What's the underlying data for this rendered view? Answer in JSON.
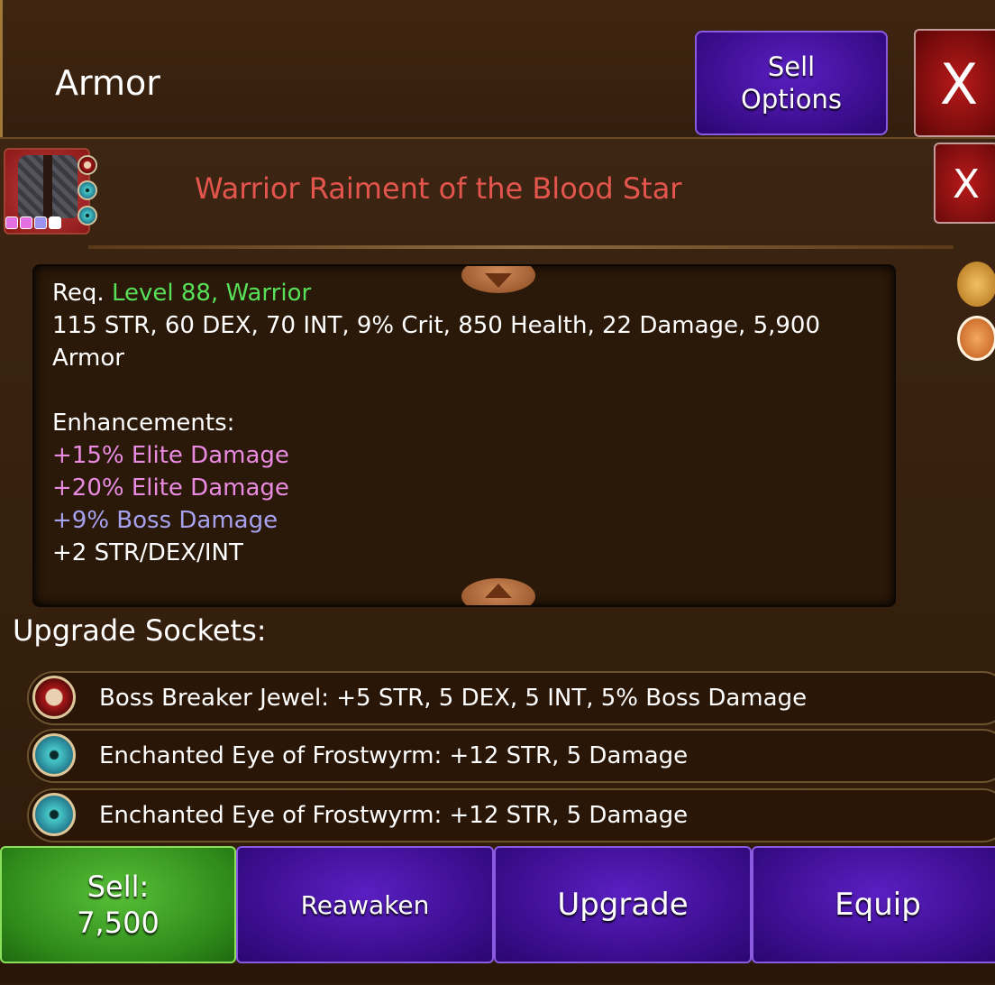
{
  "header": {
    "title": "Armor",
    "sell_options_label": "Sell\nOptions",
    "close_label": "X"
  },
  "item": {
    "name": "Warrior Raiment of the Blood Star",
    "name_color": "#e4554e",
    "close_label": "X",
    "requirement_prefix": "Req.",
    "requirement_value": "Level 88, Warrior",
    "stats_line": "115 STR, 60 DEX, 70 INT, 9% Crit, 850 Health, 22 Damage, 5,900 Armor",
    "enhancements_title": "Enhancements:",
    "enhancements": [
      {
        "text": "+15% Elite Damage",
        "color": "#e98be0"
      },
      {
        "text": "+20% Elite Damage",
        "color": "#e98be0"
      },
      {
        "text": "+9% Boss Damage",
        "color": "#a7a2f0"
      },
      {
        "text": "+2 STR/DEX/INT",
        "color": "#ffffff"
      }
    ],
    "gem_colors": [
      "#e46fe0",
      "#e46fe0",
      "#9b93f0",
      "#ffffff"
    ]
  },
  "sockets": {
    "title": "Upgrade Sockets:",
    "items": [
      {
        "icon": "skull-jewel-icon",
        "text": "Boss Breaker Jewel: +5 STR, 5 DEX, 5 INT, 5% Boss Damage"
      },
      {
        "icon": "frostwyrm-eye-icon",
        "text": "Enchanted Eye of Frostwyrm: +12 STR, 5 Damage"
      },
      {
        "icon": "frostwyrm-eye-icon",
        "text": "Enchanted Eye of Frostwyrm: +12 STR, 5 Damage"
      }
    ]
  },
  "actions": {
    "sell_label": "Sell:",
    "sell_value": "7,500",
    "reawaken_label": "Reawaken",
    "upgrade_label": "Upgrade",
    "equip_label": "Equip"
  },
  "colors": {
    "accent_purple": "#3a0c8a",
    "sell_green": "#2f8a1a",
    "close_red": "#7a0c0c"
  }
}
